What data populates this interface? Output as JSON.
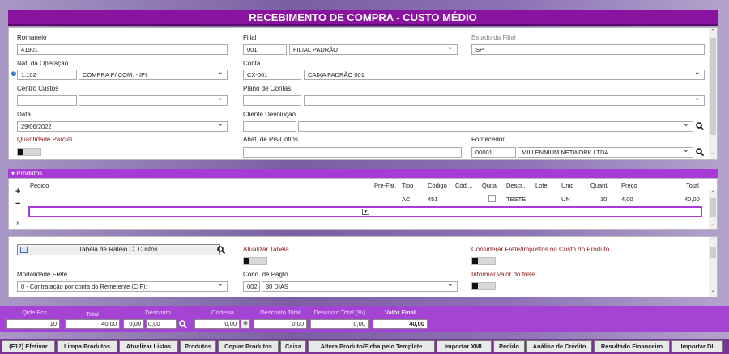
{
  "window": {
    "title": "RECEBIMENTO DE COMPRA - CUSTO MÉDIO"
  },
  "form": {
    "romaneio": {
      "label": "Romaneio",
      "value": "41901"
    },
    "filial": {
      "label": "Filial",
      "code": "001",
      "name": "FILIAL PADRÃO"
    },
    "estado_filial": {
      "label": "Estado da Filial",
      "value": "SP"
    },
    "nat_operacao": {
      "label": "Nat. da Operação",
      "code": "1.102",
      "name": "COMPRA P/ COM. - IPI"
    },
    "conta": {
      "label": "Conta",
      "code": "CX-001",
      "name": "CAIXA PADRÃO 001"
    },
    "centro_custos": {
      "label": "Centro Custos",
      "code": "",
      "name": ""
    },
    "plano_contas": {
      "label": "Plano de Contas",
      "code": "",
      "name": ""
    },
    "data": {
      "label": "Data",
      "value": "29/06/2022"
    },
    "cliente_devolucao": {
      "label": "Cliente Devolução",
      "code": "",
      "name": ""
    },
    "quantidade_parcial": {
      "label": "Quantidade Parcial"
    },
    "abat_pis": {
      "label": "Abat. de Pis/Cofins",
      "value": ""
    },
    "fornecedor": {
      "label": "Fornecedor",
      "code": "00001",
      "name": "MILLENNIUM NETWORK LTDA"
    }
  },
  "produtos": {
    "section_label": "Produtos",
    "columns": [
      "Pedido",
      "Pré-Fat.",
      "Tipo",
      "Código",
      "Códi...",
      "Quita",
      "Descr...",
      "Lote",
      "Unid",
      "Quant.",
      "Preço",
      "Total"
    ],
    "rows": [
      {
        "pedido": "",
        "prefat": "",
        "tipo": "AC",
        "codigo": "451",
        "codi": "",
        "quita": "",
        "descr": "TESTE",
        "lote": "",
        "unid": "UN",
        "quant": "10",
        "preco": "4,00",
        "total": "40,00"
      }
    ],
    "add": "+",
    "remove": "−"
  },
  "bottom": {
    "rateio_button": "Tabela de Rateio C. Custos",
    "atualizar_tabela": "Atualizar Tabela",
    "considerar_frete": "Considerar Frete/Impostos no Custo do Produto",
    "modalidade_frete": {
      "label": "Modalidade Frete",
      "value": "0 - Contratação por conta do Remetente (CIF);"
    },
    "cond_pagto": {
      "label": "Cond. de Pagto",
      "code": "002",
      "name": "30 DIAS"
    },
    "informar_frete": "Informar valor do frete"
  },
  "totals": {
    "labels": [
      "Qtde Pcs",
      "Total",
      "Desconto",
      "Cortesia",
      "Desconto Total",
      "Desconto Total (%)",
      "Valor Final"
    ],
    "qtde_pcs": "10",
    "total": "40,00",
    "desconto_pct": "0,00",
    "desconto_val": "0,00",
    "cortesia": "0,00",
    "desconto_total": "0,00",
    "desconto_total_pct": "0,00",
    "valor_final": "40,00"
  },
  "buttons": [
    "(F12) Efetivar",
    "Limpa Produtos",
    "Atualizar Listas",
    "Produtos",
    "Copiar Produtos",
    "Caixa",
    "Altera Produto/Ficha pelo Template",
    "Importar XML",
    "Pedido",
    "Análise de Crédito",
    "Resultado Financeiro",
    "Importar DI"
  ],
  "colors": {
    "title": "#8a149f",
    "section": "#a83ad6",
    "totals": "#a544d4",
    "buttonbar": "#7b3296"
  }
}
